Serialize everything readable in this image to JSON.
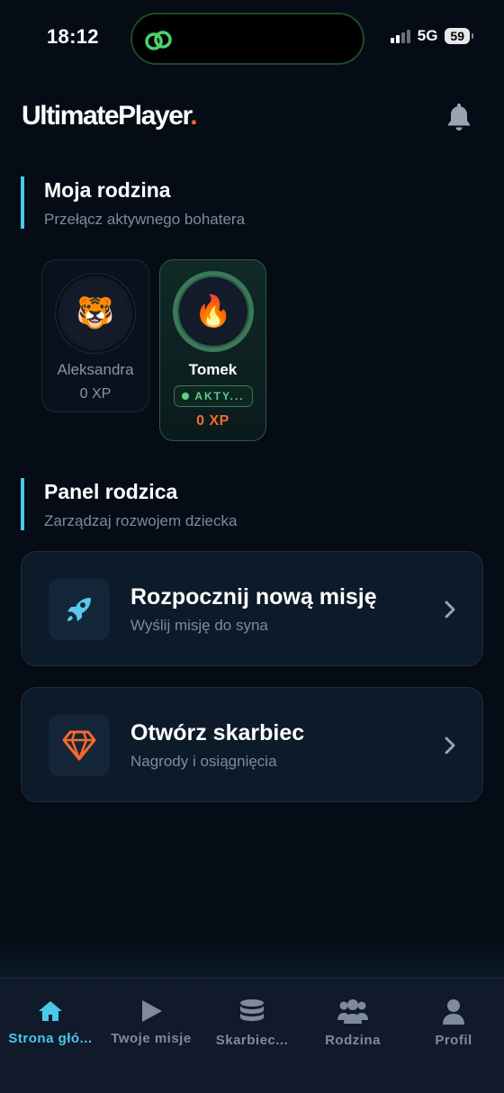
{
  "status": {
    "time": "18:12",
    "network": "5G",
    "battery": "59"
  },
  "header": {
    "brand": "UltimatePlayer",
    "brand_dot": "."
  },
  "family": {
    "title": "Moja rodzina",
    "subtitle": "Przełącz aktywnego bohatera",
    "members": [
      {
        "name": "Aleksandra",
        "xp": "0 XP",
        "avatar": "🐯",
        "active": false
      },
      {
        "name": "Tomek",
        "xp": "0 XP",
        "avatar": "🔥",
        "active": true,
        "badge": "AKTY..."
      }
    ]
  },
  "parent_panel": {
    "title": "Panel rodzica",
    "subtitle": "Zarządzaj rozwojem dziecka",
    "actions": [
      {
        "title": "Rozpocznij nową misję",
        "subtitle": "Wyślij misję do syna",
        "icon": "rocket-icon"
      },
      {
        "title": "Otwórz skarbiec",
        "subtitle": "Nagrody i osiągnięcia",
        "icon": "diamond-icon"
      }
    ]
  },
  "nav": {
    "items": [
      {
        "label": "Strona głó...",
        "icon": "home-icon",
        "active": true
      },
      {
        "label": "Twoje misje",
        "icon": "play-icon",
        "active": false
      },
      {
        "label": "Skarbiec...",
        "icon": "database-icon",
        "active": false
      },
      {
        "label": "Rodzina",
        "icon": "users-icon",
        "active": false
      },
      {
        "label": "Profil",
        "icon": "user-icon",
        "active": false
      }
    ]
  },
  "colors": {
    "accent": "#49c9e8",
    "brand_dot": "#f26a2e",
    "active_green": "#5fcf8e",
    "xp_orange": "#f26a2e"
  }
}
